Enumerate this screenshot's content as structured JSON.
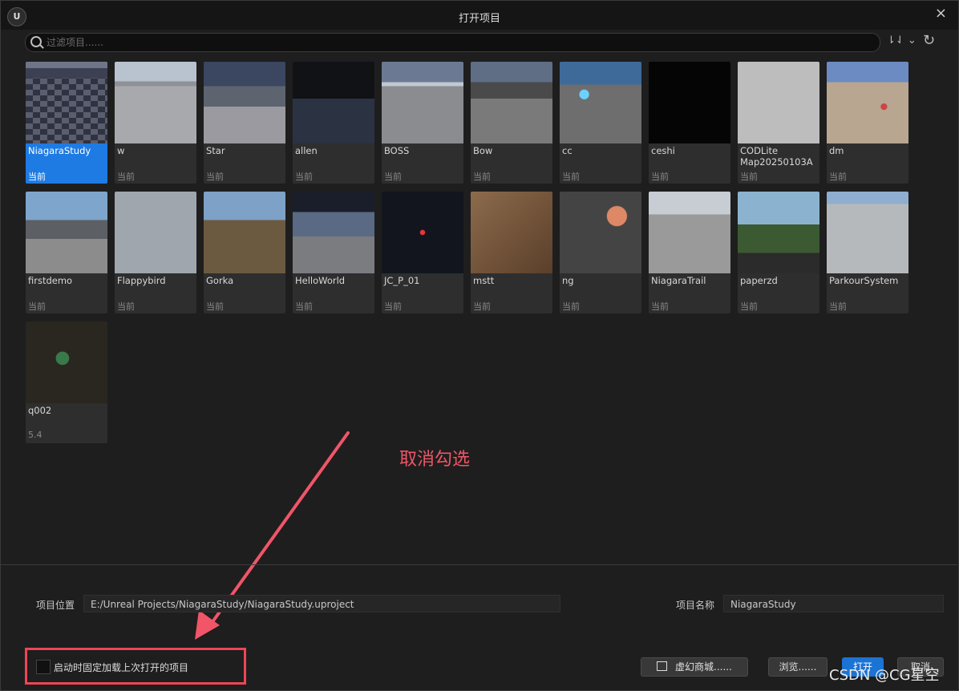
{
  "window": {
    "title": "打开项目",
    "close_icon": "×",
    "logo": "U"
  },
  "search": {
    "placeholder": "过滤项目......"
  },
  "toolbar": {
    "sort_icon": "⇂⇃ ⌄",
    "refresh_icon": "↻"
  },
  "projects": [
    {
      "name": "NiagaraStudy",
      "version": "当前",
      "selected": true
    },
    {
      "name": "w",
      "version": "当前"
    },
    {
      "name": "Star",
      "version": "当前"
    },
    {
      "name": "allen",
      "version": "当前"
    },
    {
      "name": "BOSS",
      "version": "当前"
    },
    {
      "name": "Bow",
      "version": "当前"
    },
    {
      "name": "cc",
      "version": "当前"
    },
    {
      "name": "ceshi",
      "version": "当前"
    },
    {
      "name": "CODLite Map20250103A",
      "version": "当前"
    },
    {
      "name": "dm",
      "version": "当前"
    },
    {
      "name": "firstdemo",
      "version": "当前"
    },
    {
      "name": "Flappybird",
      "version": "当前"
    },
    {
      "name": "Gorka",
      "version": "当前"
    },
    {
      "name": "HelloWorld",
      "version": "当前"
    },
    {
      "name": "JC_P_01",
      "version": "当前"
    },
    {
      "name": "mstt",
      "version": "当前"
    },
    {
      "name": "ng",
      "version": "当前"
    },
    {
      "name": "NiagaraTrail",
      "version": "当前"
    },
    {
      "name": "paperzd",
      "version": "当前"
    },
    {
      "name": "ParkourSystem",
      "version": "当前"
    },
    {
      "name": "q002",
      "version": "5.4"
    }
  ],
  "annotation": {
    "text": "取消勾选",
    "color": "#f05568"
  },
  "footer": {
    "location_label": "项目位置",
    "location_value": "E:/Unreal Projects/NiagaraStudy/NiagaraStudy.uproject",
    "name_label": "项目名称",
    "name_value": "NiagaraStudy",
    "checkbox_label": "启动时固定加载上次打开的项目",
    "checkbox_checked": false,
    "marketplace_label": "虚幻商城......",
    "browse_label": "浏览......",
    "open_label": "打开",
    "cancel_label": "取消"
  },
  "watermark": "CSDN @CG星空"
}
